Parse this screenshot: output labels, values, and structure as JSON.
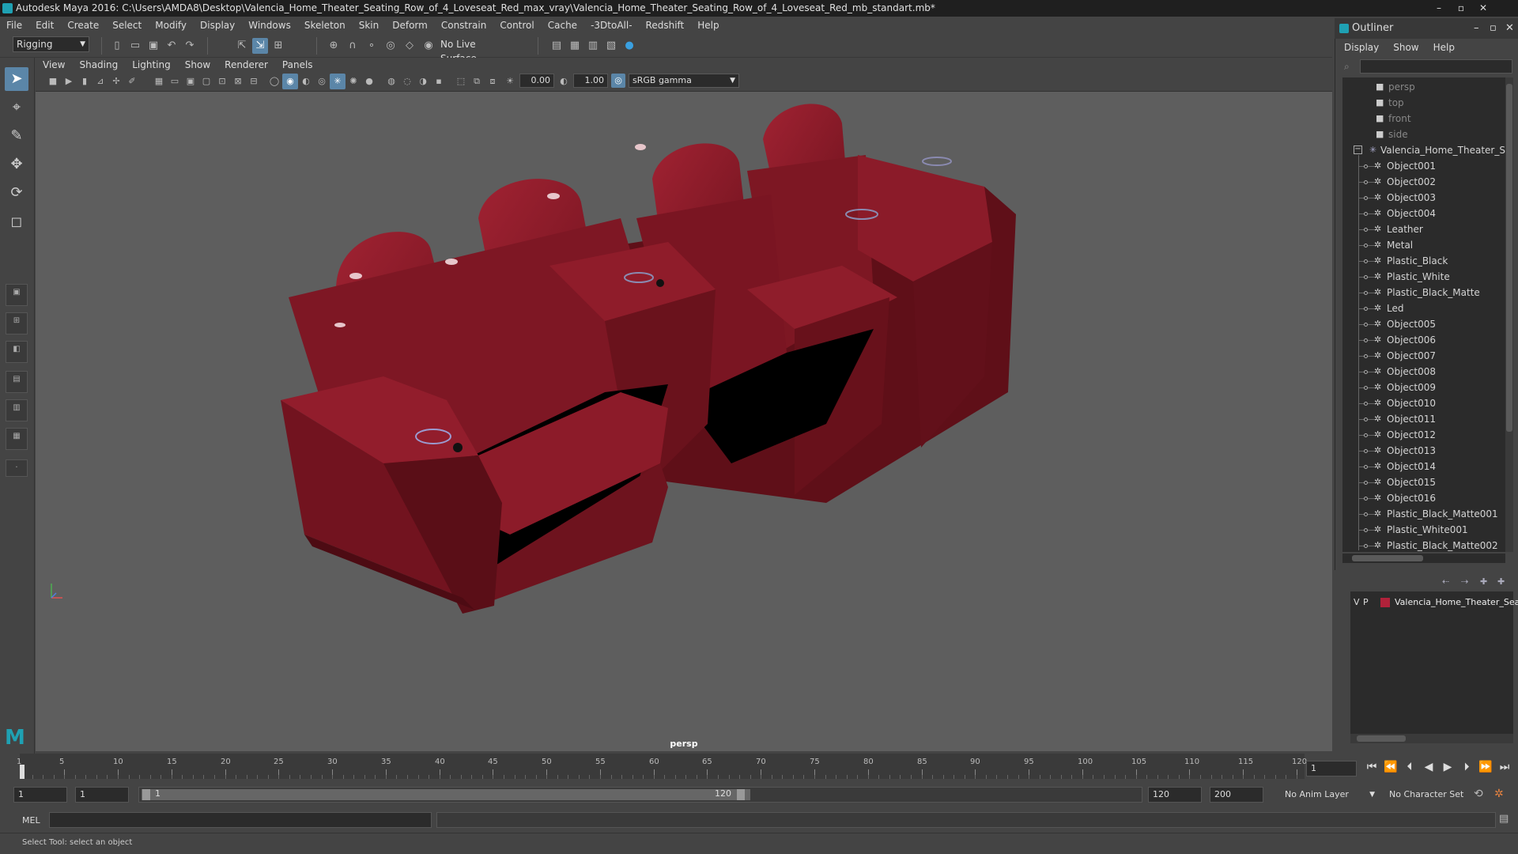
{
  "window": {
    "title": "Autodesk Maya 2016: C:\\Users\\AMDA8\\Desktop\\Valencia_Home_Theater_Seating_Row_of_4_Loveseat_Red_max_vray\\Valencia_Home_Theater_Seating_Row_of_4_Loveseat_Red_mb_standart.mb*",
    "minimize": "–",
    "maximize": "▫",
    "close": "✕"
  },
  "menu": [
    "File",
    "Edit",
    "Create",
    "Select",
    "Modify",
    "Display",
    "Windows",
    "Skeleton",
    "Skin",
    "Deform",
    "Constrain",
    "Control",
    "Cache",
    "-3DtoAll-",
    "Redshift",
    "Help"
  ],
  "shelf": {
    "mode": "Rigging",
    "live_surface": "No Live Surface"
  },
  "viewport": {
    "menu": [
      "View",
      "Shading",
      "Lighting",
      "Show",
      "Renderer",
      "Panels"
    ],
    "exposure": "0.00",
    "gamma": "1.00",
    "color_space": "sRGB gamma",
    "camera_label": "persp"
  },
  "outliner": {
    "title": "Outliner",
    "menu": [
      "Display",
      "Show",
      "Help"
    ],
    "cameras": [
      "persp",
      "top",
      "front",
      "side"
    ],
    "group": "Valencia_Home_Theater_Sea",
    "children": [
      "Object001",
      "Object002",
      "Object003",
      "Object004",
      "Leather",
      "Metal",
      "Plastic_Black",
      "Plastic_White",
      "Plastic_Black_Matte",
      "Led",
      "Object005",
      "Object006",
      "Object007",
      "Object008",
      "Object009",
      "Object010",
      "Object011",
      "Object012",
      "Object013",
      "Object014",
      "Object015",
      "Object016",
      "Plastic_Black_Matte001",
      "Plastic_White001",
      "Plastic_Black_Matte002"
    ]
  },
  "layers": {
    "v": "V",
    "p": "P",
    "layer_name": "Valencia_Home_Theater_Seat",
    "layer_color": "#b0223a"
  },
  "timeline": {
    "ticks": [
      "1",
      "5",
      "10",
      "15",
      "20",
      "25",
      "30",
      "35",
      "40",
      "45",
      "50",
      "55",
      "60",
      "65",
      "70",
      "75",
      "80",
      "85",
      "90",
      "95",
      "100",
      "105",
      "110",
      "115",
      "120"
    ],
    "current_frame": "1"
  },
  "range": {
    "start": "1",
    "start_inner": "1",
    "slider_start": "1",
    "slider_end": "120",
    "end": "120",
    "end_outer": "200",
    "anim_layer": "No Anim Layer",
    "char_set": "No Character Set"
  },
  "mel": {
    "label": "MEL"
  },
  "status": {
    "help": "Select Tool: select an object"
  },
  "colors": {
    "sofa": "#7a1522",
    "viewport_bg": "#5e5e5e",
    "accent": "#5b86a8"
  }
}
